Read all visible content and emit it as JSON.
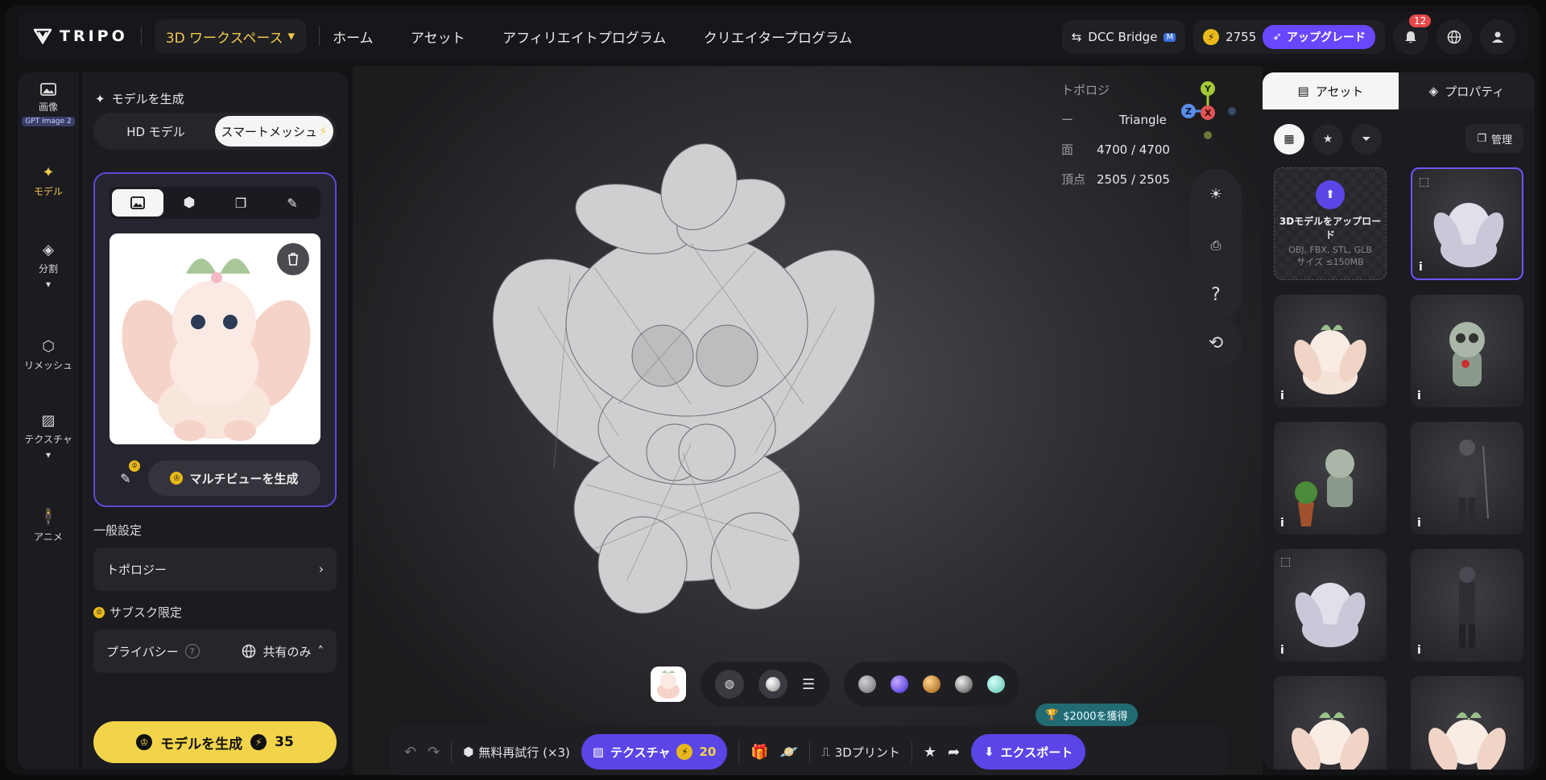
{
  "header": {
    "logo_text": "TRIPO",
    "workspace_label": "3D ワークスペース",
    "nav": [
      "ホーム",
      "アセット",
      "アフィリエイトプログラム",
      "クリエイタープログラム"
    ],
    "dcc_bridge": "DCC Bridge",
    "credits": "2755",
    "upgrade_label": "アップグレード",
    "notification_count": "12"
  },
  "rail": {
    "items": [
      {
        "label": "画像",
        "chip": "GPT Image 2"
      },
      {
        "label": "モデル"
      },
      {
        "label": "分割"
      },
      {
        "label": "リメッシュ"
      },
      {
        "label": "テクスチャ"
      },
      {
        "label": "アニメ"
      }
    ]
  },
  "panel": {
    "title": "モデルを生成",
    "seg_hd": "HD モデル",
    "seg_smart": "スマートメッシュ",
    "multiview_label": "マルチビューを生成",
    "general_settings": "一般設定",
    "topology_label": "トポロジー",
    "subscription_label": "サブスク限定",
    "privacy_label": "プライバシー",
    "privacy_value": "共有のみ",
    "generate_label": "モデルを生成",
    "generate_cost": "35"
  },
  "viewport": {
    "topology_key": "トポロジー",
    "topology_value": "Triangle",
    "faces_key": "面",
    "faces_value": "4700 / 4700",
    "verts_key": "頂点",
    "verts_value": "2505 / 2505",
    "help_label": "?",
    "materials": [
      "#8a8a8e",
      "#7a5cff",
      "#d98a2b",
      "#9c9ca2",
      "#8fe0d4"
    ]
  },
  "actions": {
    "retry_label": "無料再試行 (×3)",
    "texture_label": "テクスチャ",
    "texture_cost": "20",
    "print_label": "3Dプリント",
    "export_label": "エクスポート",
    "promo_label": "$2000を獲得"
  },
  "right_panel": {
    "tab_assets": "アセット",
    "tab_properties": "プロパティ",
    "manage_label": "管理",
    "upload_title": "3Dモデルをアップロード",
    "upload_formats": "OBJ, FBX, STL, GLB",
    "upload_size": "サイズ ≤150MB",
    "info_label": "i"
  }
}
